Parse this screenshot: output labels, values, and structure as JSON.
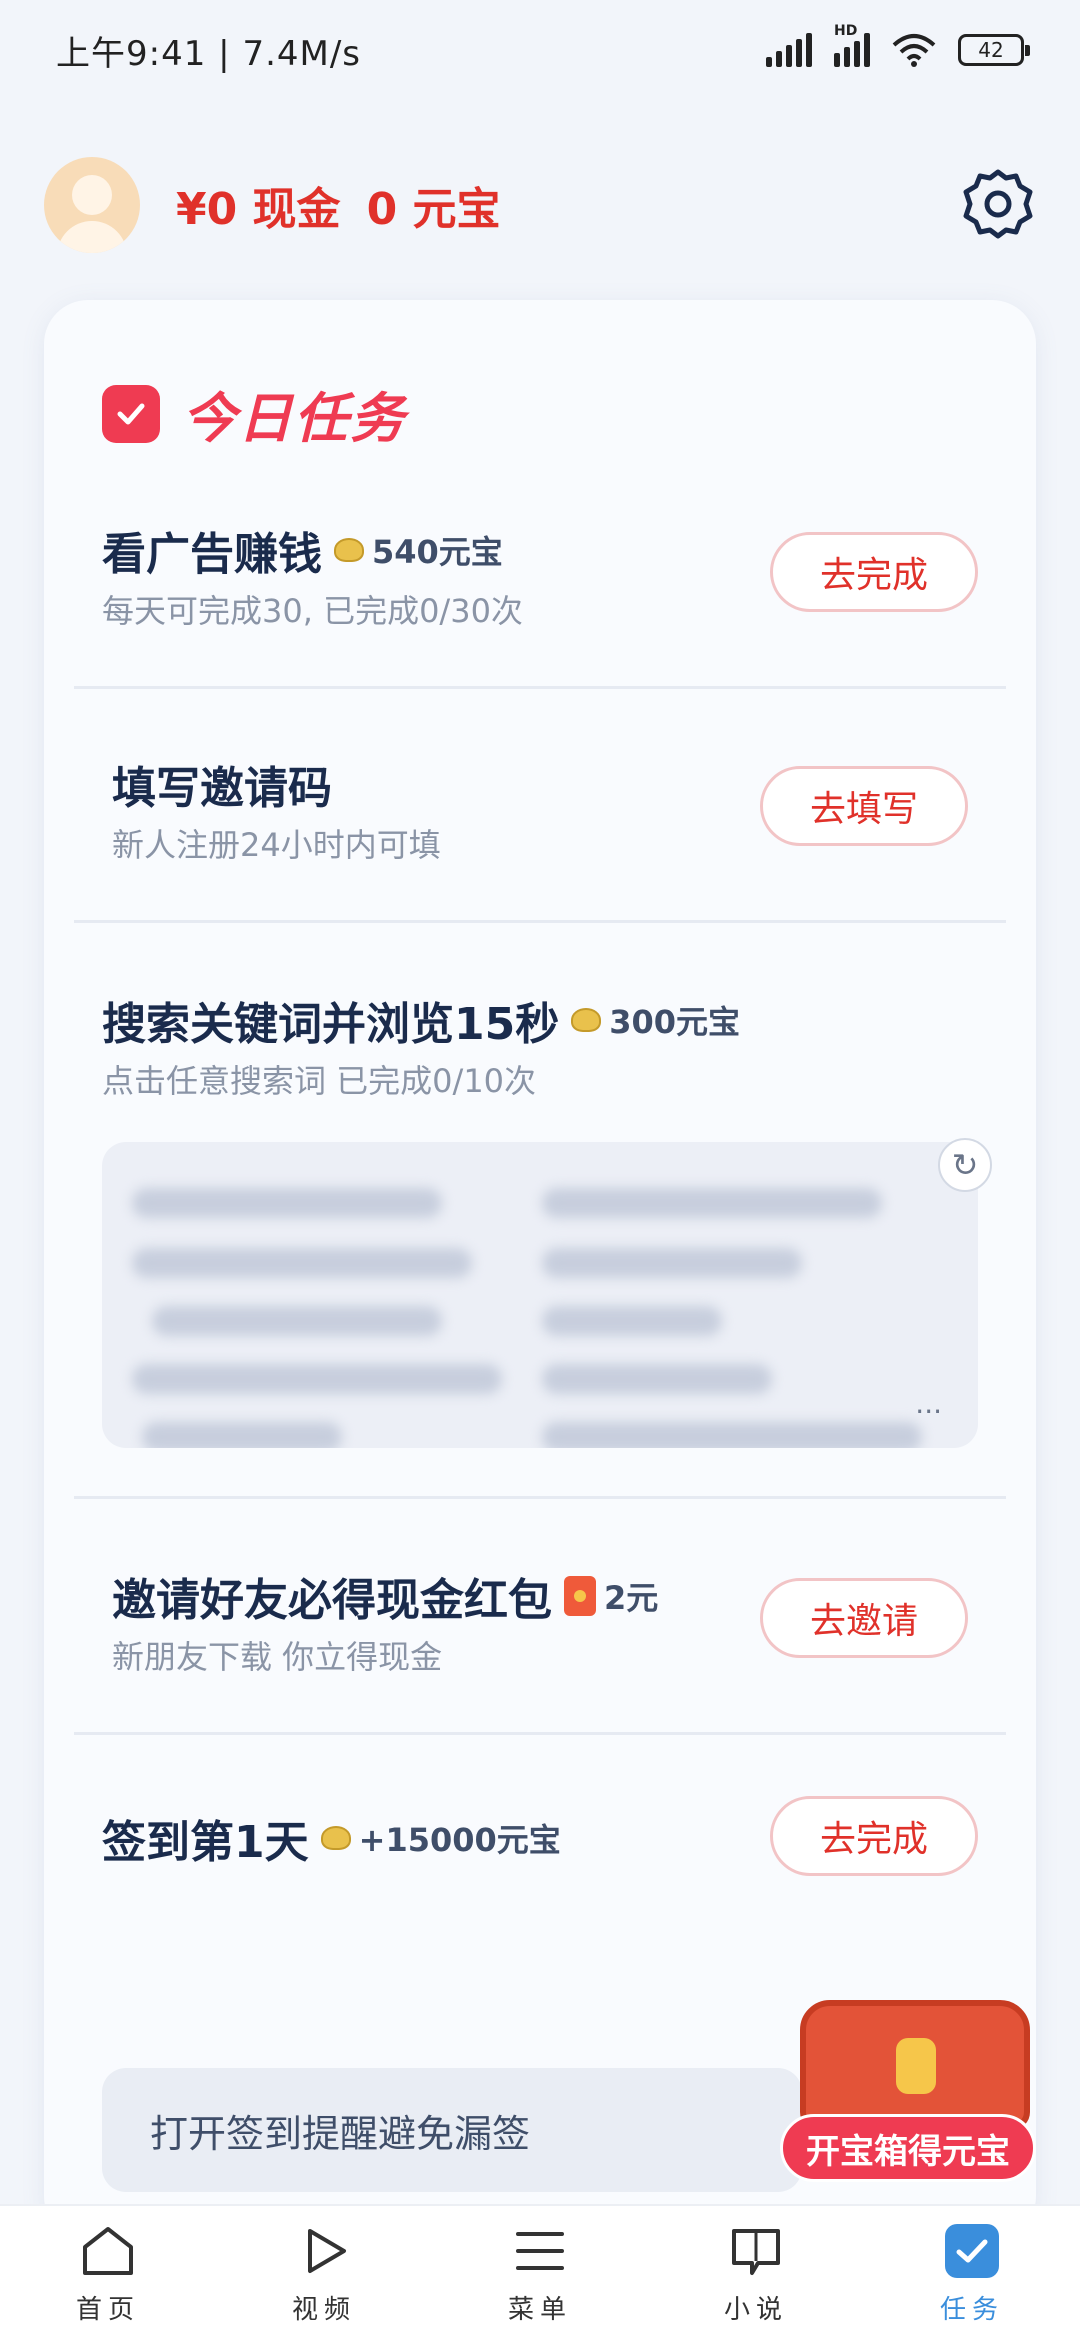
{
  "status_bar": {
    "time": "上午9:41",
    "speed": "7.4M/s",
    "battery": "42",
    "hd": "HD"
  },
  "header": {
    "cash": "¥0 现金",
    "yuanbao": "0 元宝"
  },
  "card": {
    "title": "今日任务"
  },
  "tasks": [
    {
      "name": "看广告赚钱",
      "reward": "540元宝",
      "sub": "每天可完成30, 已完成0/30次",
      "button": "去完成"
    },
    {
      "name": "填写邀请码",
      "reward": "",
      "sub": "新人注册24小时内可填",
      "button": "去填写"
    },
    {
      "name": "搜索关键词并浏览15秒",
      "reward": "300元宝",
      "sub": "点击任意搜索词 已完成0/10次",
      "button": ""
    },
    {
      "name": "邀请好友必得现金红包",
      "reward": "2元",
      "sub": "新朋友下载 你立得现金",
      "button": "去邀请"
    },
    {
      "name": "签到第1天",
      "reward": "+15000元宝",
      "sub": "",
      "button": "去完成"
    }
  ],
  "search_box": {
    "ellipsis": "..."
  },
  "tip": "打开签到提醒避免漏签",
  "treasure": {
    "label": "开宝箱得元宝"
  },
  "nav": [
    {
      "label": "首页",
      "icon": "home-icon"
    },
    {
      "label": "视频",
      "icon": "play-icon"
    },
    {
      "label": "菜单",
      "icon": "menu-icon"
    },
    {
      "label": "小说",
      "icon": "book-icon"
    },
    {
      "label": "任务",
      "icon": "task-check-icon",
      "active": true
    }
  ],
  "colors": {
    "accent_red": "#e0312a",
    "title_red": "#ef3b52",
    "nav_active": "#3a8edc"
  }
}
